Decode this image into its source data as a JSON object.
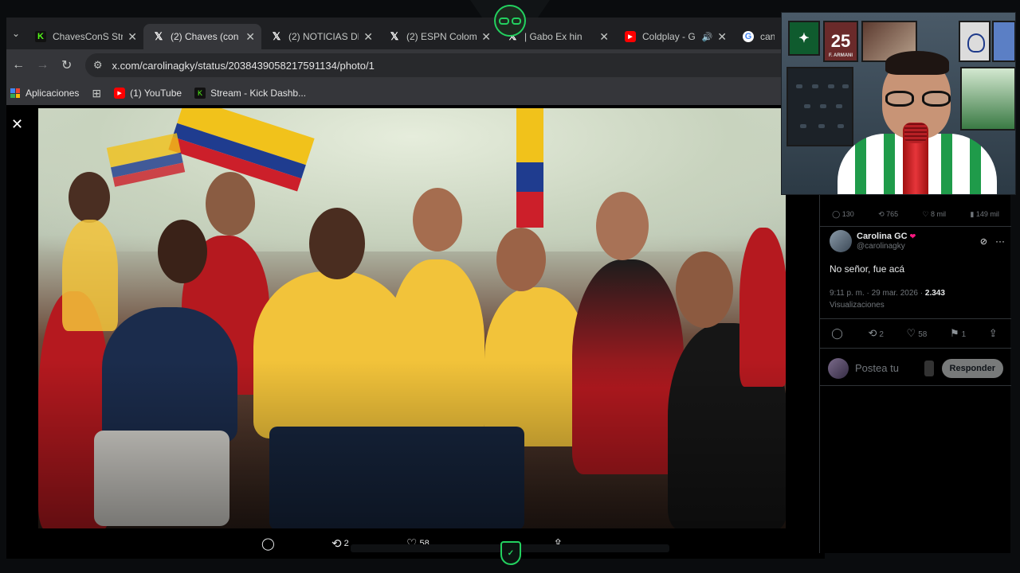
{
  "browser": {
    "tabs": [
      {
        "title": "ChavesConS Stre",
        "favicon": "kick-icon",
        "active": false,
        "audio": false
      },
      {
        "title": "(2) Chaves (con",
        "favicon": "x-icon",
        "active": true,
        "audio": false
      },
      {
        "title": "(2) NOTICIAS DE",
        "favicon": "x-icon",
        "active": false,
        "audio": false
      },
      {
        "title": "(2) ESPN Colom",
        "favicon": "x-icon",
        "active": false,
        "audio": false
      },
      {
        "title": "| Gabo Ex hin",
        "favicon": "x-icon",
        "active": false,
        "audio": false
      },
      {
        "title": "Coldplay - G",
        "favicon": "youtube-icon",
        "active": false,
        "audio": true
      },
      {
        "title": "canc",
        "favicon": "google-icon",
        "active": false,
        "audio": false
      }
    ],
    "url": "x.com/carolinagky/status/2038439058217591134/photo/1",
    "bookmarks": [
      {
        "label": "Aplicaciones",
        "icon": "apps-grid-icon"
      },
      {
        "label": "(1) YouTube",
        "icon": "youtube-icon"
      },
      {
        "label": "Stream - Kick Dashb...",
        "icon": "kick-icon"
      }
    ]
  },
  "photo_actions": {
    "reply": "",
    "retweets": "2",
    "likes": "58",
    "share": ""
  },
  "previous_stats": {
    "replies": "130",
    "retweets": "765",
    "likes": "8 mil",
    "views": "149 mil"
  },
  "post": {
    "author_name": "Carolina GC",
    "author_handle": "@carolinagky",
    "text": "No señor, fue acá",
    "timestamp": "9:11 p. m. · 29 mar. 2026 ·",
    "views_count": "2.343",
    "views_label": "Visualizaciones",
    "actions": {
      "retweets": "2",
      "likes": "58",
      "bookmarks": "1"
    }
  },
  "reply_box": {
    "placeholder": "Postea tu",
    "button_label": "Responder"
  },
  "webcam": {
    "frame_number": "25",
    "frame_caption": "F. ARMANI"
  },
  "colors": {
    "accent_green": "#23d15f",
    "x_background": "#000000",
    "chrome_tab_bg": "#1f2023",
    "chrome_toolbar": "#35363a"
  }
}
